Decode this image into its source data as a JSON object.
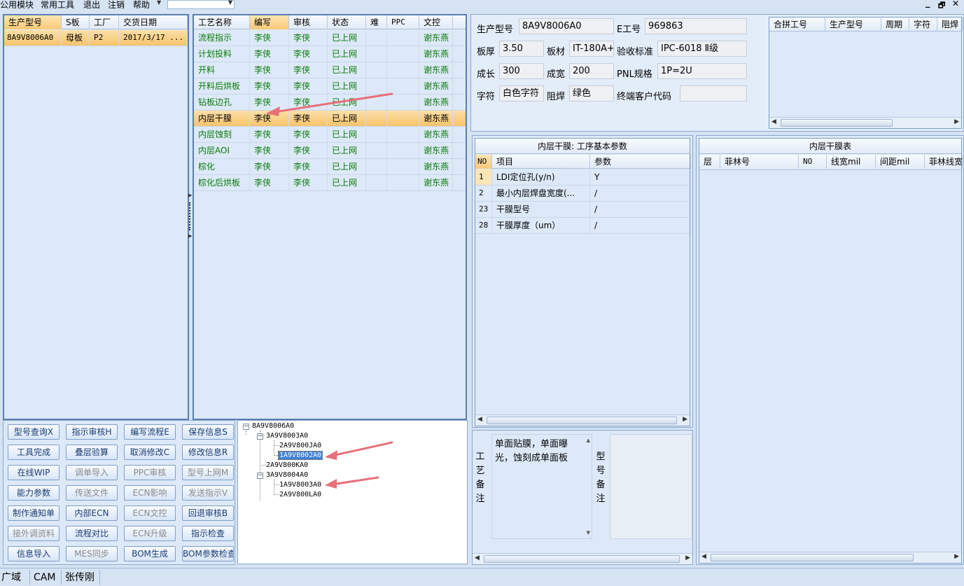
{
  "menubar": {
    "items": [
      "公用模块",
      "常用工具",
      "退出",
      "注销",
      "帮助"
    ],
    "window_controls": [
      "_",
      "🗗",
      "✕"
    ]
  },
  "order_grid": {
    "columns": [
      "生产型号",
      "S板",
      "工厂",
      "交货日期"
    ],
    "rows": [
      {
        "model": "8A9V8006A0",
        "board": "母板",
        "factory": "P2",
        "date": "2017/3/17 ..."
      }
    ]
  },
  "process_grid": {
    "columns": [
      "工艺名称",
      "编写",
      "审核",
      "状态",
      "难",
      "PPC",
      "文控"
    ],
    "rows": [
      [
        "流程指示",
        "李侠",
        "李侠",
        "已上网",
        "",
        "",
        "谢东燕"
      ],
      [
        "计划投料",
        "李侠",
        "李侠",
        "已上网",
        "",
        "",
        "谢东燕"
      ],
      [
        "开料",
        "李侠",
        "李侠",
        "已上网",
        "",
        "",
        "谢东燕"
      ],
      [
        "开料后烘板",
        "李侠",
        "李侠",
        "已上网",
        "",
        "",
        "谢东燕"
      ],
      [
        "钻板边孔",
        "李侠",
        "李侠",
        "已上网",
        "",
        "",
        "谢东燕"
      ],
      [
        "内层干膜",
        "李侠",
        "李侠",
        "已上网",
        "",
        "",
        "谢东燕"
      ],
      [
        "内层蚀刻",
        "李侠",
        "李侠",
        "已上网",
        "",
        "",
        "谢东燕"
      ],
      [
        "内层AOI",
        "李侠",
        "李侠",
        "已上网",
        "",
        "",
        "谢东燕"
      ],
      [
        "棕化",
        "李侠",
        "李侠",
        "已上网",
        "",
        "",
        "谢东燕"
      ],
      [
        "棕化后烘板",
        "李侠",
        "李侠",
        "已上网",
        "",
        "",
        "谢东燕"
      ]
    ],
    "selected_index": 5
  },
  "product_info": {
    "model_label": "生产型号",
    "model_value": "8A9V8006A0",
    "eno_label": "E工号",
    "eno_value": "969863",
    "thickness_label": "板厚",
    "thickness_value": "3.50",
    "material_label": "板材",
    "material_value": "IT-180A+",
    "standard_label": "验收标准",
    "standard_value": "IPC-6018 Ⅱ级",
    "length_label": "成长",
    "length_value": "300",
    "width_label": "成宽",
    "width_value": "200",
    "pnl_label": "PNL规格",
    "pnl_value": "1P=2U",
    "char_label": "字符",
    "char_value": "白色字符",
    "mask_label": "阻焊",
    "mask_value": "绿色",
    "customer_label": "终端客户代码",
    "customer_value": ""
  },
  "merge_grid": {
    "columns": [
      "合拼工号",
      "生产型号",
      "周期",
      "字符",
      "阻焊"
    ]
  },
  "params_panel": {
    "title": "内层干膜: 工序基本参数",
    "columns": [
      "NO",
      "项目",
      "参数"
    ],
    "rows": [
      [
        "1",
        "LDI定位孔(y/n)",
        "Y"
      ],
      [
        "2",
        "最小内层焊盘宽度(...",
        "/"
      ],
      [
        "23",
        "干膜型号",
        "/"
      ],
      [
        "28",
        "干膜厚度（um）",
        "/"
      ]
    ]
  },
  "film_table": {
    "title": "内层干膜表",
    "columns": [
      "层",
      "菲林号",
      "NO",
      "线宽mil",
      "间距mil",
      "菲林线宽"
    ]
  },
  "buttons": [
    [
      "型号查询X",
      "指示审核H",
      "编写流程E",
      "保存信息S"
    ],
    [
      "工具完成",
      "叠层验算",
      "取消修改C",
      "修改信息R"
    ],
    [
      "在线WIP",
      "调单导入",
      "PPC审核",
      "型号上网M"
    ],
    [
      "能力参数",
      "传送文件",
      "ECN影响",
      "发送指示V"
    ],
    [
      "制作通知单",
      "内部ECN",
      "ECN文控",
      "回退审核B"
    ],
    [
      "接外调资料",
      "流程对比",
      "ECN升级",
      "指示检查"
    ],
    [
      "信息导入",
      "MES同步",
      "BOM生成",
      "BOM参数检查"
    ]
  ],
  "tree": {
    "root": "8A9V8006A0",
    "n1": "3A9V8003A0",
    "n1a": "2A9V800JA0",
    "n1b": "1A9V8002A0",
    "n2": "2A9V800KA0",
    "n3": "3A9V8004A0",
    "n3a": "1A9V8003A0",
    "n3b": "2A9V800LA0"
  },
  "memo": {
    "process_label": "工艺备注",
    "process_text_line1": "单面贴膜，单面曝",
    "process_text_line2": "光，蚀刻成单面板",
    "model_label": "型号备注"
  },
  "statusbar": {
    "items": [
      "广域网",
      "CAM",
      "张传刚"
    ]
  },
  "colors": {
    "accent": "#5a7fb1",
    "selected_row": "#f6c36c",
    "status_green": "#0b7a0b",
    "annotation_arrow": "#e8707a"
  }
}
